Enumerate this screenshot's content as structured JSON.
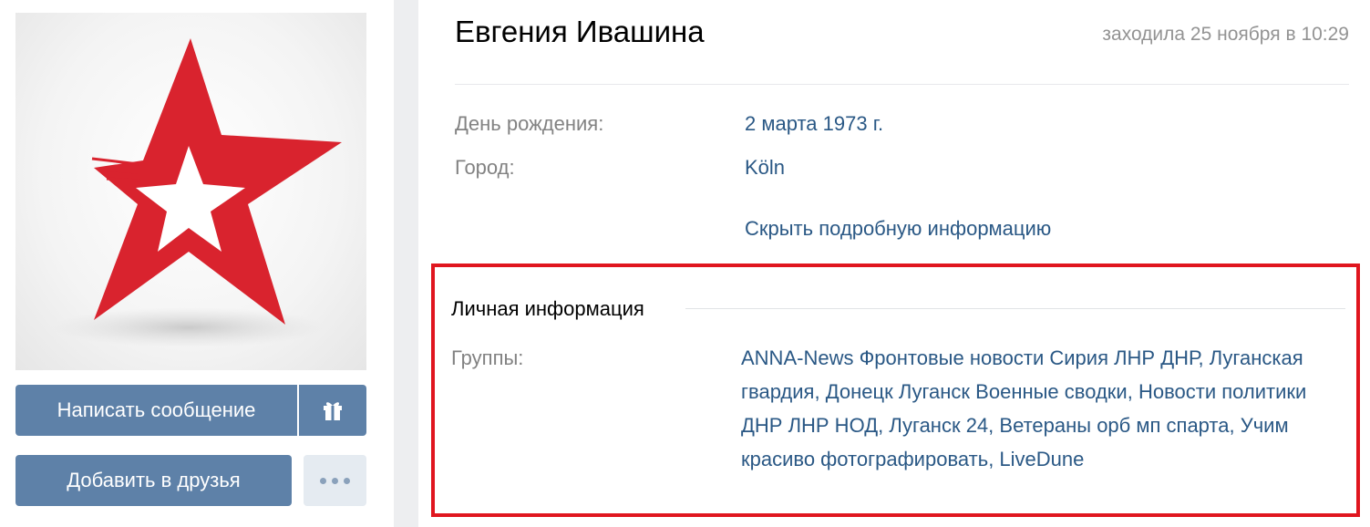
{
  "profile": {
    "name": "Евгения Ивашина",
    "last_seen": "заходила 25 ноября в 10:29"
  },
  "buttons": {
    "message": "Написать сообщение",
    "gift_icon": "gift-icon",
    "add_friend": "Добавить в друзья",
    "more_icon": "more-dots-icon"
  },
  "info": {
    "birthday_label": "День рождения:",
    "birthday_value": "2 марта 1973 г.",
    "city_label": "Город:",
    "city_value": "Köln",
    "toggle_link": "Скрыть подробную информацию"
  },
  "personal": {
    "title": "Личная информация",
    "groups_label": "Группы:",
    "groups": [
      "ANNA-News Фронтовые новости Сирия ЛНР ДНР",
      "Луганская гвардия",
      "Донецк Луганск Военные сводки",
      "Новости политики ДНР ЛНР НОД",
      "Луганск 24",
      "Ветераны орб мп спарта",
      "Учим красиво фотографировать",
      "LiveDune"
    ]
  },
  "colors": {
    "accent": "#5e81a8",
    "link": "#2a5885",
    "highlight_border": "#e0161f",
    "star": "#d9232e"
  }
}
